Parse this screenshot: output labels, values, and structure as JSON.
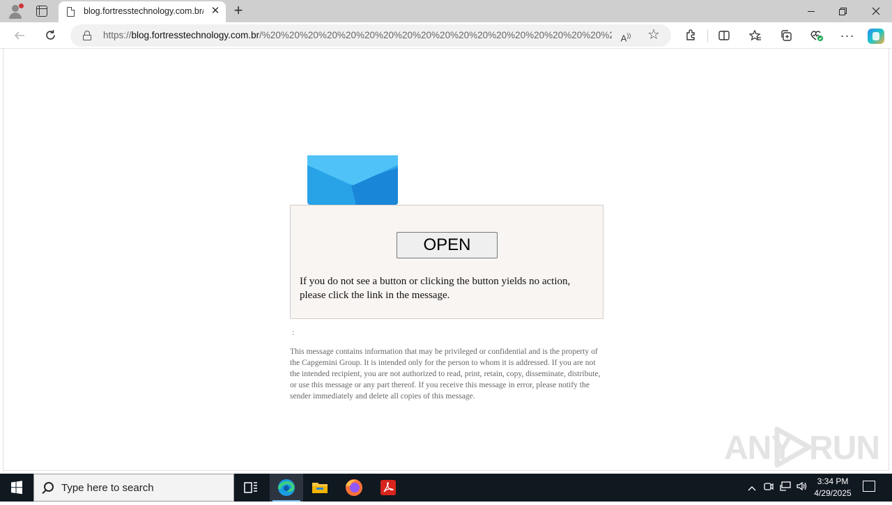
{
  "browser": {
    "tab_title": "blog.fortresstechnology.com.br/",
    "tab_close_glyph": "✕",
    "new_tab_glyph": "+",
    "url_scheme": "https://",
    "url_host": "blog.fortresstechnology.com.br",
    "url_path": "/%20%20%20%20%20%20%20%20%20%20%20%20%20%20%20%20%20%20%2...",
    "read_aloud_glyph": "A",
    "icons": [
      "profile-icon",
      "tab-actions-icon",
      "page-icon",
      "back-icon",
      "reload-icon",
      "lock-icon",
      "read-aloud-icon",
      "favorite-star-icon",
      "extensions-icon",
      "split-screen-icon",
      "favorites-icon",
      "collections-icon",
      "browser-essentials-icon",
      "more-icon",
      "copilot-icon"
    ]
  },
  "page": {
    "open_button_label": "OPEN",
    "message": "If you do not see a button or clicking the button yields no action, please click the link in the message.",
    "separator": ":",
    "disclaimer": "This message contains information that may be privileged or confidential and is the property of the Capgemini Group. It is intended only for the person to whom it is addressed. If you are not the intended recipient, you are not authorized to read, print, retain, copy, disseminate, distribute, or use this message or any part thereof. If you receive this message in error, please notify the sender immediately and delete all copies of this message.",
    "envelope_colors": {
      "back": "#29a3e8",
      "flap": "#4fc3f7",
      "right": "#1a86d8"
    }
  },
  "watermark": {
    "left": "ANY",
    "right": "RUN"
  },
  "taskbar": {
    "search_placeholder": "Type here to search",
    "time": "3:34 PM",
    "date": "4/29/2025",
    "apps": [
      "task-view-icon",
      "edge-icon",
      "file-explorer-icon",
      "firefox-icon",
      "acrobat-icon"
    ],
    "tray_icons": [
      "chevron-up-icon",
      "meet-icon",
      "network-icon",
      "volume-icon",
      "notification-icon"
    ]
  },
  "colors": {
    "titlebar": "#cfcfcf",
    "taskbar": "#101820",
    "card_bg": "#f8f5f3"
  }
}
